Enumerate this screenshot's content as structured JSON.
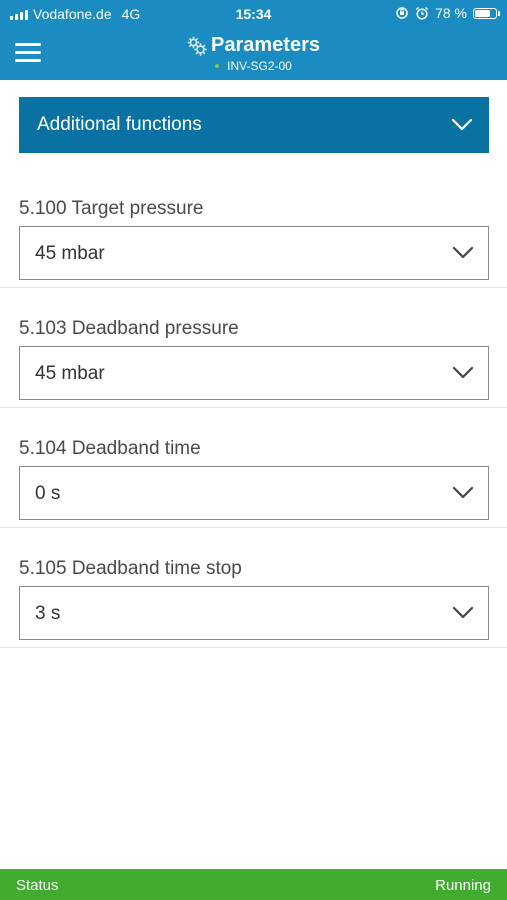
{
  "status_bar": {
    "carrier": "Vodafone.de",
    "network": "4G",
    "time": "15:34",
    "battery_text": "78 %",
    "battery_level": 0.78
  },
  "header": {
    "title": "Parameters",
    "subtitle": "INV-SG2-00",
    "menu_icon": "hamburger-icon",
    "title_icon": "gears-icon"
  },
  "section": {
    "label": "Additional functions",
    "icon": "chevron-down-icon"
  },
  "parameters": [
    {
      "label": "5.100 Target pressure",
      "value": "45 mbar"
    },
    {
      "label": "5.103 Deadband pressure",
      "value": "45 mbar"
    },
    {
      "label": "5.104 Deadband time",
      "value": "0 s"
    },
    {
      "label": "5.105 Deadband time stop",
      "value": "3 s"
    }
  ],
  "footer": {
    "label": "Status",
    "value": "Running"
  },
  "colors": {
    "header_blue": "#1a8cc2",
    "section_blue": "#0a72a3",
    "status_green": "#40ab2f",
    "subtitle_dot": "#8bc34a"
  }
}
